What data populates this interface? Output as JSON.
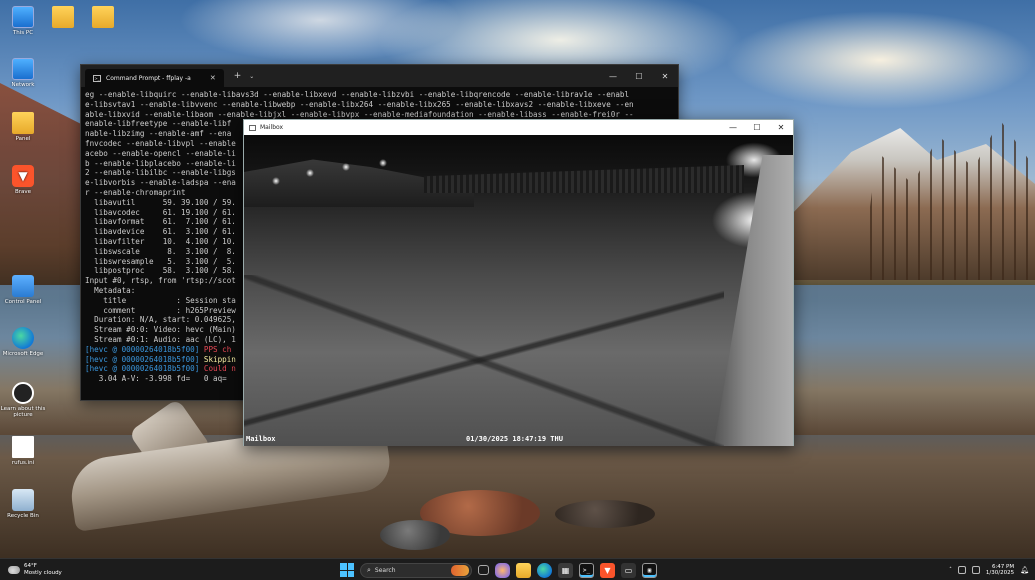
{
  "desktop": {
    "icons": [
      {
        "label": "This PC"
      },
      {
        "label": "Network"
      },
      {
        "label": "Panel"
      },
      {
        "label": "Brave"
      },
      {
        "label": "Control Panel"
      },
      {
        "label": "Microsoft Edge"
      },
      {
        "label": "Learn about this picture"
      },
      {
        "label": "rufus.ini"
      },
      {
        "label": "Recycle Bin"
      }
    ]
  },
  "cmd": {
    "tab_title": "Command Prompt - ffplay -a",
    "new_tab": "+",
    "dropdown": "⌄",
    "minimize": "—",
    "maximize": "☐",
    "close": "✕",
    "lines": [
      "eg --enable-libquirc --enable-libavs3d --enable-libxevd --enable-libzvbi --enable-libqrencode --enable-librav1e --enabl",
      "e-libsvtav1 --enable-libvvenc --enable-libwebp --enable-libx264 --enable-libx265 --enable-libxavs2 --enable-libxeve --en",
      "able-libxvid --enable-libaom --enable-libjxl --enable-libvpx --enable-mediafoundation --enable-libass --enable-frei0r --",
      "enable-libfreetype --enable-libf",
      "nable-libzimg --enable-amf --ena",
      "fnvcodec --enable-libvpl --enable",
      "acebo --enable-opencl --enable-li",
      "b --enable-libplacebo --enable-li",
      "2 --enable-libilbc --enable-libgs",
      "e-libvorbis --enable-ladspa --ena",
      "r --enable-chromaprint",
      "  libavutil      59. 39.100 / 59.",
      "  libavcodec     61. 19.100 / 61.",
      "  libavformat    61.  7.100 / 61.",
      "  libavdevice    61.  3.100 / 61.",
      "  libavfilter    10.  4.100 / 10.",
      "  libswscale      8.  3.100 /  8.",
      "  libswresample   5.  3.100 /  5.",
      "  libpostproc    58.  3.100 / 58.",
      "Input #0, rtsp, from 'rtsp://scot",
      "  Metadata:",
      "    title           : Session sta",
      "    comment         : h265Preview",
      "  Duration: N/A, start: 0.049625,",
      "  Stream #0:0: Video: hevc (Main)",
      "  Stream #0:1: Audio: aac (LC), 1"
    ],
    "hevc_lines": [
      {
        "prefix": "[hevc @ 00000264018b5f00] ",
        "msg": "PPS ch"
      },
      {
        "prefix": "[hevc @ 00000264018b5f00] ",
        "msg": "Skippin"
      },
      {
        "prefix": "[hevc @ 00000264018b5f00] ",
        "msg": "Could n"
      }
    ],
    "status_line": "   3.04 A-V: -3.998 fd=   0 aq="
  },
  "mailbox": {
    "title": "Mailbox",
    "minimize": "—",
    "maximize": "☐",
    "close": "✕",
    "overlay_name": "Mailbox",
    "overlay_timestamp": "01/30/2025 18:47:19 THU"
  },
  "taskbar": {
    "weather_temp": "64°F",
    "weather_desc": "Mostly cloudy",
    "search_placeholder": "Search",
    "time": "6:47 PM",
    "date": "1/30/2025"
  }
}
